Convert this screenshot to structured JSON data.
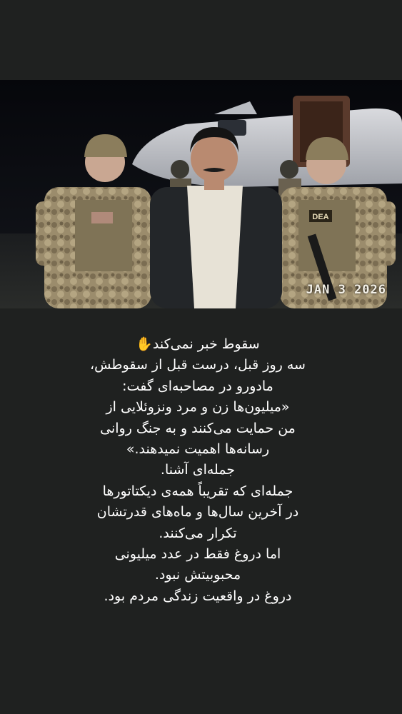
{
  "photo": {
    "date_stamp": "JAN 3 2026",
    "vest_patch": "DEA"
  },
  "caption": {
    "lines": [
      "سقوط خبر نمی‌کند✋",
      "سه روز قبل، درست قبل از سقوطش،",
      "مادورو در مصاحبه‌ای گفت:",
      "«میلیون‌ها زن و مرد ونزوئلایی از",
      "من حمایت می‌کنند و به جنگ روانی",
      "رسانه‌ها اهمیت نمیدهند.»",
      "جمله‌ای آشنا.",
      "جمله‌ای که تقریباً همه‌ی دیکتاتورها",
      "در آخرین سال‌ها و ماه‌های قدرتشان",
      "تکرار می‌کنند.",
      "اما دروغ فقط در عدد میلیونی",
      "محبوبیتش نبود.",
      "دروغ در واقعیت زندگی مردم بود."
    ]
  },
  "colors": {
    "background": "#1f2120",
    "text": "#ffffff"
  }
}
